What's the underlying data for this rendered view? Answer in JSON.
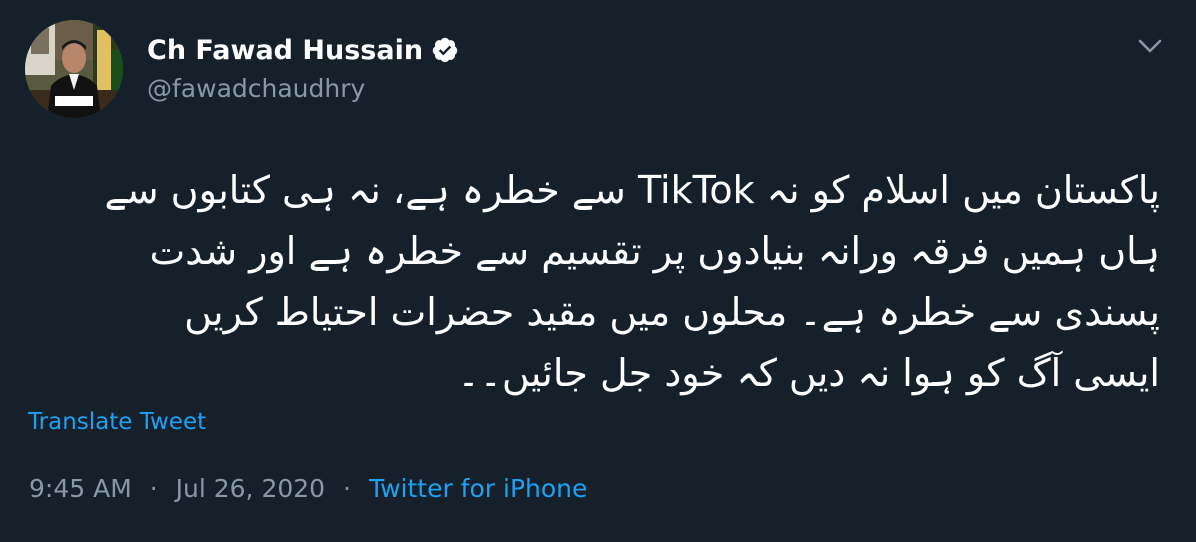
{
  "user": {
    "display_name": "Ch Fawad Hussain",
    "handle": "@fawadchaudhry",
    "verified": true
  },
  "tweet": {
    "lines": [
      "پاکستان میں اسلام کو نہ TikTok سے خطرہ ہے، نہ ہی کتابوں سے",
      "ہاں ہمیں فرقہ ورانہ بنیادوں پر تقسیم سے خطرہ ہے اور شدت",
      "پسندی سے خطرہ ہے۔ محلوں میں مقید حضرات احتیاط کریں",
      "ایسی آگ کو ہوا نہ دیں کہ خود جل جائیں۔۔"
    ],
    "translate_label": "Translate Tweet",
    "time": "9:45 AM",
    "separator": "·",
    "date": "Jul 26, 2020",
    "source": "Twitter for iPhone"
  },
  "colors": {
    "background": "#15202b",
    "text": "#ffffff",
    "muted": "#8899a6",
    "link": "#1da1f2"
  },
  "icons": {
    "verified": "verified-badge-icon",
    "menu": "chevron-down-icon"
  }
}
